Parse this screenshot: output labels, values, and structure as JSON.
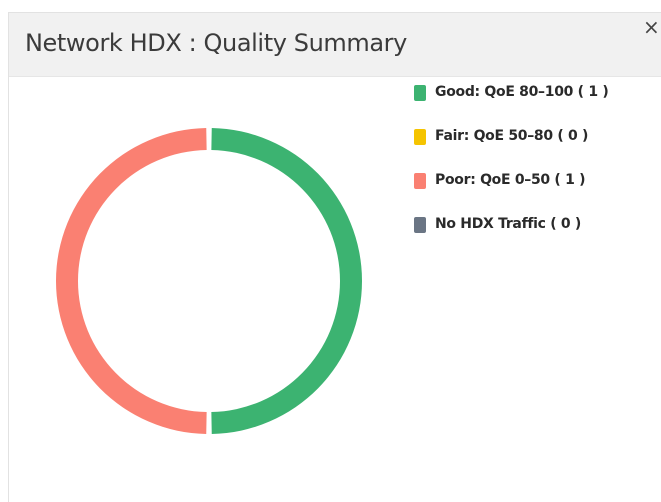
{
  "panel": {
    "title": "Network HDX : Quality Summary",
    "close_label": "×"
  },
  "chart_data": {
    "type": "pie",
    "style": "donut",
    "categories": [
      "Good: QoE 80–100",
      "Fair: QoE 50–80",
      "Poor: QoE 0–50",
      "No HDX Traffic"
    ],
    "values": [
      1,
      0,
      1,
      0
    ],
    "colors": [
      "#3cb371",
      "#f5c400",
      "#fa8072",
      "#6a7584"
    ],
    "legend_position": "right"
  },
  "legend": {
    "items": [
      {
        "label": "Good: QoE 80–100 ( 1 )",
        "color": "#3cb371"
      },
      {
        "label": "Fair: QoE 50–80 ( 0 )",
        "color": "#f5c400"
      },
      {
        "label": "Poor: QoE 0–50 ( 1 )",
        "color": "#fa8072"
      },
      {
        "label": "No HDX Traffic ( 0 )",
        "color": "#6a7584"
      }
    ]
  }
}
